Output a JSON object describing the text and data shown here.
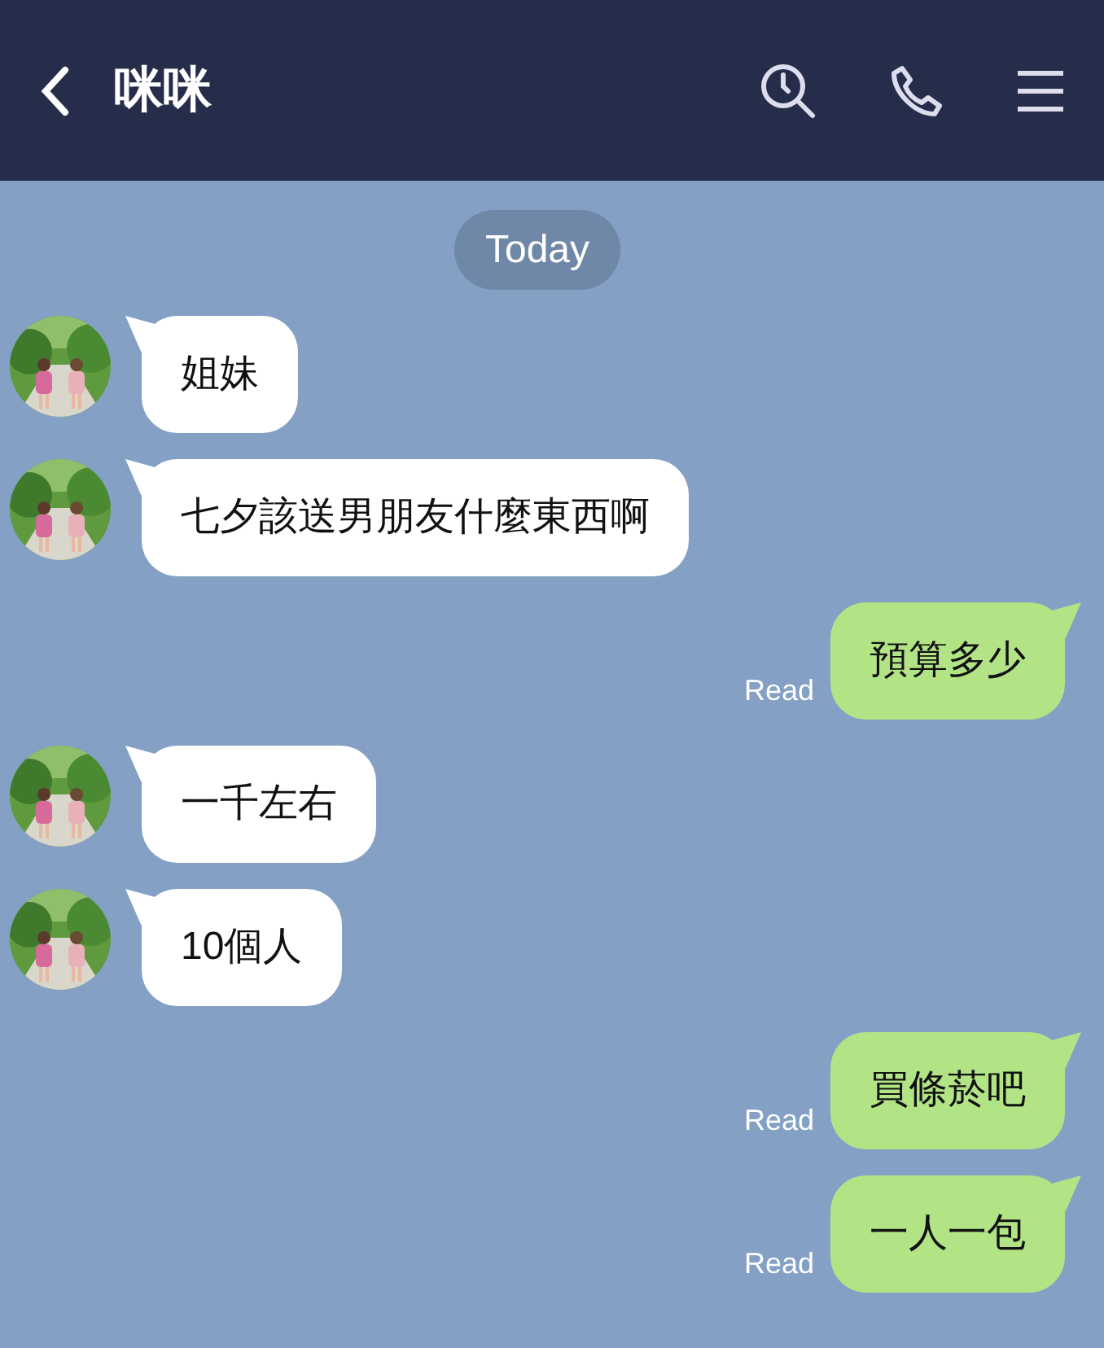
{
  "header": {
    "title": "咪咪"
  },
  "date_label": "Today",
  "messages": [
    {
      "kind": "received",
      "text": "姐妹"
    },
    {
      "kind": "received",
      "text": "七夕該送男朋友什麼東西啊"
    },
    {
      "kind": "sent",
      "text": "預算多少",
      "status": "Read"
    },
    {
      "kind": "received",
      "text": "一千左右"
    },
    {
      "kind": "received",
      "text": "10個人"
    },
    {
      "kind": "sent",
      "text": "買條菸吧",
      "status": "Read"
    },
    {
      "kind": "sent",
      "text": "一人一包",
      "status": "Read"
    }
  ]
}
